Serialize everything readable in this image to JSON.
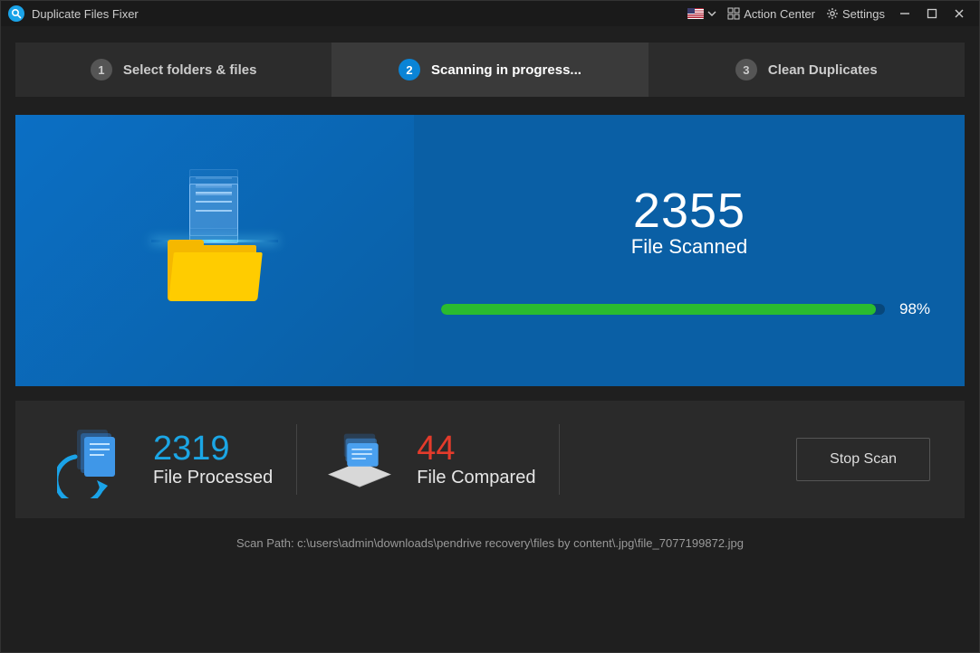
{
  "titlebar": {
    "app_name": "Duplicate Files Fixer",
    "action_center": "Action Center",
    "settings": "Settings"
  },
  "steps": {
    "s1": {
      "num": "1",
      "label": "Select folders & files"
    },
    "s2": {
      "num": "2",
      "label": "Scanning in progress..."
    },
    "s3": {
      "num": "3",
      "label": "Clean Duplicates"
    }
  },
  "scan": {
    "count": "2355",
    "count_label": "File Scanned",
    "progress_pct": 98,
    "progress_label": "98%"
  },
  "stats": {
    "processed": {
      "num": "2319",
      "label": "File Processed"
    },
    "compared": {
      "num": "44",
      "label": "File Compared"
    },
    "stop_label": "Stop Scan"
  },
  "scan_path": "Scan Path: c:\\users\\admin\\downloads\\pendrive recovery\\files by content\\.jpg\\file_7077199872.jpg"
}
